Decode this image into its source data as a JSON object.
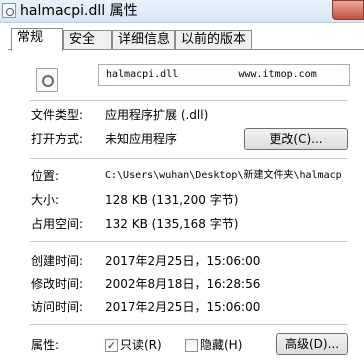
{
  "window": {
    "title": "halmacpi.dll 属性"
  },
  "tabs": [
    {
      "label": "常规",
      "active": true
    },
    {
      "label": "安全",
      "active": false
    },
    {
      "label": "详细信息",
      "active": false
    },
    {
      "label": "以前的版本",
      "active": false
    }
  ],
  "general": {
    "file_name": "halmacpi.dll          www.itmop.com",
    "file_type_label": "文件类型:",
    "file_type_value": "应用程序扩展 (.dll)",
    "open_with_label": "打开方式:",
    "open_with_value": "未知应用程序",
    "change_button": "更改(C)...",
    "location_label": "位置:",
    "location_value": "C:\\Users\\wuhan\\Desktop\\新建文件夹\\halmacp",
    "size_label": "大小:",
    "size_value": "128 KB (131,200 字节)",
    "size_on_disk_label": "占用空间:",
    "size_on_disk_value": "132 KB (135,168 字节)",
    "created_label": "创建时间:",
    "created_value": "2017年2月25日，15:06:00",
    "modified_label": "修改时间:",
    "modified_value": "2002年8月18日，16:28:56",
    "accessed_label": "访问时间:",
    "accessed_value": "2017年2月25日，15:06:00",
    "attributes_label": "属性:",
    "readonly_label": "只读(R)",
    "readonly_checked": true,
    "hidden_label": "隐藏(H)",
    "hidden_checked": false,
    "advanced_button": "高级(D)..."
  }
}
